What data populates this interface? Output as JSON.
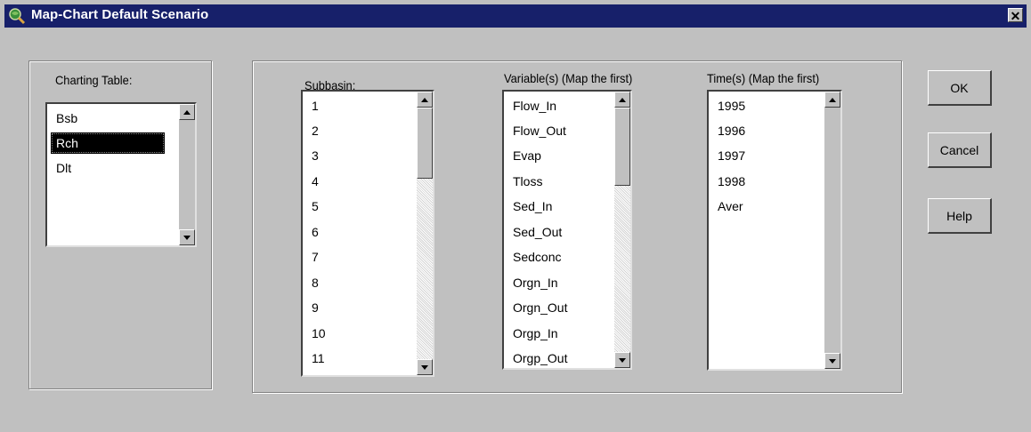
{
  "window": {
    "title": "Map-Chart Default Scenario",
    "close_glyph": "✕"
  },
  "charting_table": {
    "label": "Charting Table:",
    "items": [
      "Bsb",
      "Rch",
      "Dlt"
    ],
    "selected": "Rch"
  },
  "subbasin": {
    "label": "Subbasin:",
    "items": [
      "1",
      "2",
      "3",
      "4",
      "5",
      "6",
      "7",
      "8",
      "9",
      "10",
      "11"
    ]
  },
  "variables": {
    "label": "Variable(s) (Map the first)",
    "items": [
      "Flow_In",
      "Flow_Out",
      "Evap",
      "Tloss",
      "Sed_In",
      "Sed_Out",
      "Sedconc",
      "Orgn_In",
      "Orgn_Out",
      "Orgp_In",
      "Orgp_Out"
    ]
  },
  "times": {
    "label": "Time(s)  (Map the first)",
    "items": [
      "1995",
      "1996",
      "1997",
      "1998",
      "Aver"
    ]
  },
  "buttons": {
    "ok": "OK",
    "cancel": "Cancel",
    "help": "Help"
  },
  "icons": {
    "window": "globe-magnifier-icon",
    "close": "close-icon",
    "scroll_up": "arrow-up-icon",
    "scroll_down": "arrow-down-icon"
  },
  "colors": {
    "titlebar": "#17206a",
    "face": "#c0c0c0",
    "selection": "#000000"
  }
}
